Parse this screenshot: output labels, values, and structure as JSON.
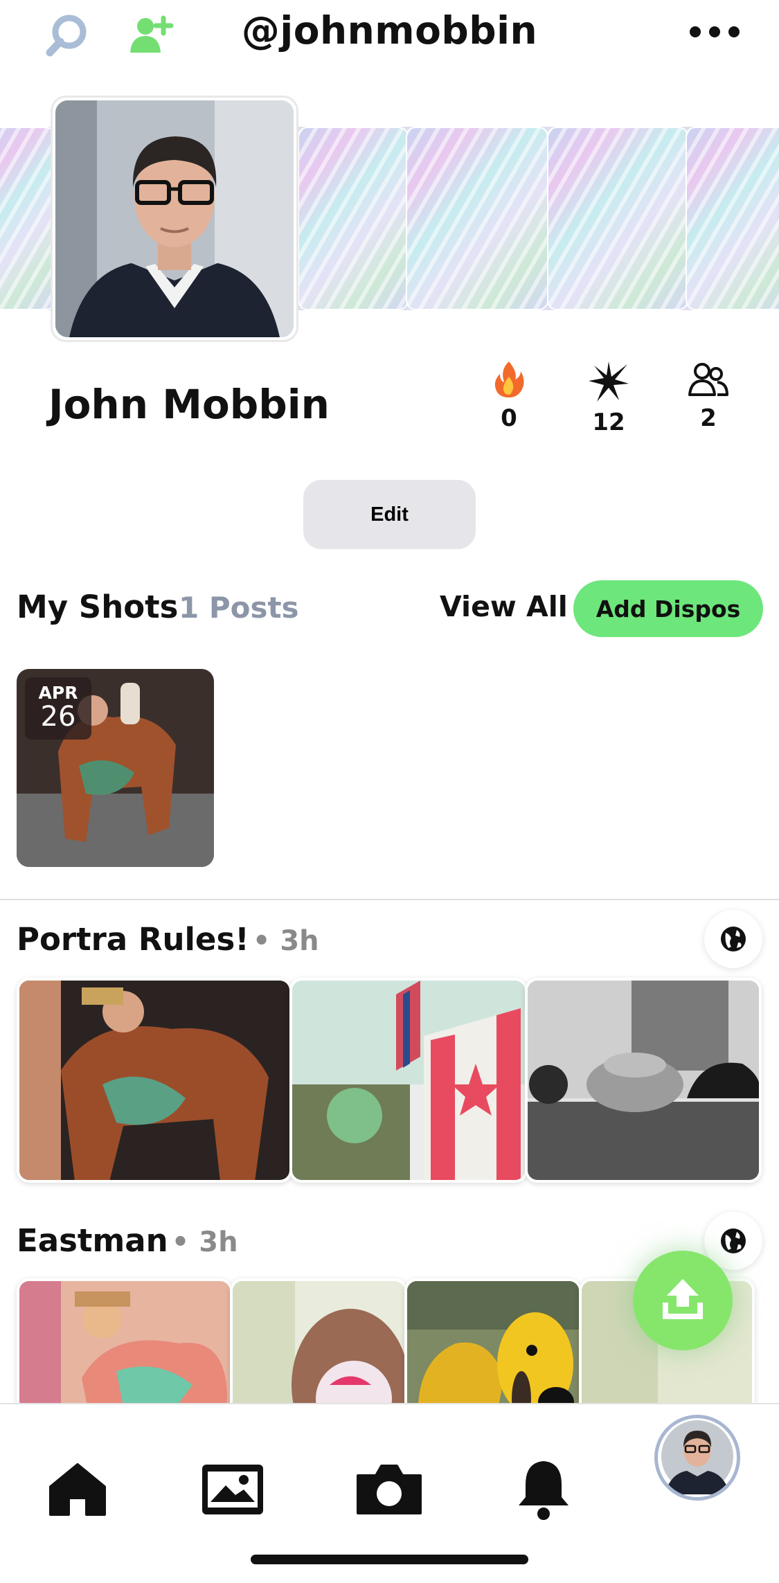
{
  "header": {
    "handle": "@johnmobbin",
    "search_icon": "search-icon",
    "add_friend_icon": "add-person-icon",
    "more_icon": "more-dots-icon"
  },
  "profile": {
    "name": "John Mobbin",
    "stats": [
      {
        "icon": "fire-icon",
        "value": "0"
      },
      {
        "icon": "spark-icon",
        "value": "12"
      },
      {
        "icon": "people-icon",
        "value": "2"
      }
    ],
    "edit_label": "Edit"
  },
  "my_shots": {
    "title": "My Shots",
    "count": "1 Posts",
    "view_all": "View All",
    "add_dispos": "Add Dispos",
    "thumb_month": "APR",
    "thumb_day": "26"
  },
  "albums": [
    {
      "title": "Portra Rules!",
      "time": "• 3h",
      "visibility_icon": "globe-icon"
    },
    {
      "title": "Eastman",
      "time": "• 3h",
      "visibility_icon": "globe-icon"
    }
  ],
  "fab_icon": "upload-icon",
  "tabbar": [
    "home-icon",
    "gallery-icon",
    "camera-icon",
    "bell-icon",
    "profile-avatar"
  ],
  "colors": {
    "accent_green": "#6de67b",
    "muted_text": "#8d96a8",
    "button_gray": "#e6e6ea"
  }
}
